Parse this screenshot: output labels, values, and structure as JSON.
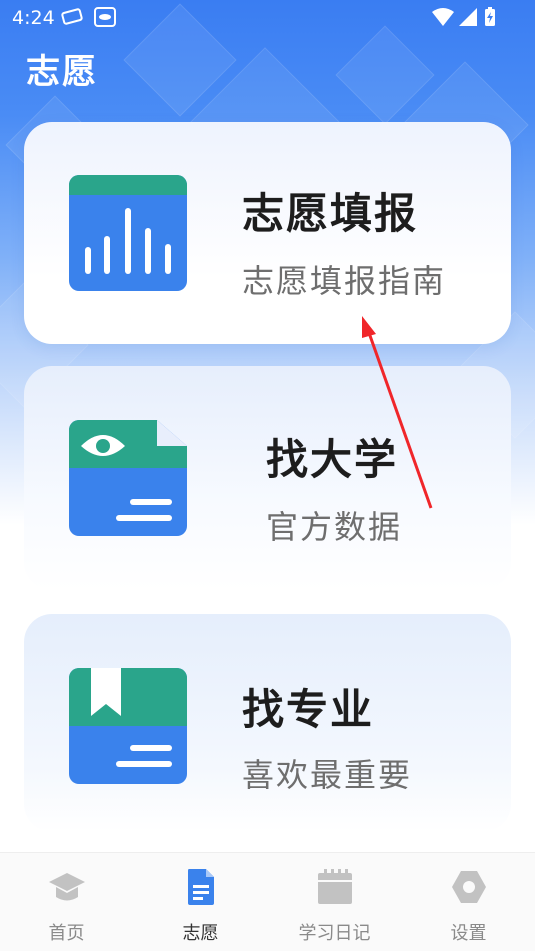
{
  "status_bar": {
    "time": "4:24"
  },
  "header": {
    "title": "志愿"
  },
  "cards": [
    {
      "title": "志愿填报",
      "subtitle": "志愿填报指南",
      "icon": "bar-chart-icon"
    },
    {
      "title": "找大学",
      "subtitle": "官方数据",
      "icon": "document-eye-icon"
    },
    {
      "title": "找专业",
      "subtitle": "喜欢最重要",
      "icon": "bookmark-book-icon"
    }
  ],
  "tabs": [
    {
      "label": "首页",
      "icon": "graduation-cap-icon",
      "active": false
    },
    {
      "label": "志愿",
      "icon": "document-icon",
      "active": true
    },
    {
      "label": "学习日记",
      "icon": "calendar-icon",
      "active": false
    },
    {
      "label": "设置",
      "icon": "hexagon-settings-icon",
      "active": false
    }
  ],
  "colors": {
    "accent": "#3a82ec",
    "green": "#2aa58b",
    "header_blue": "#3a7df2",
    "arrow": "#f0262a"
  }
}
